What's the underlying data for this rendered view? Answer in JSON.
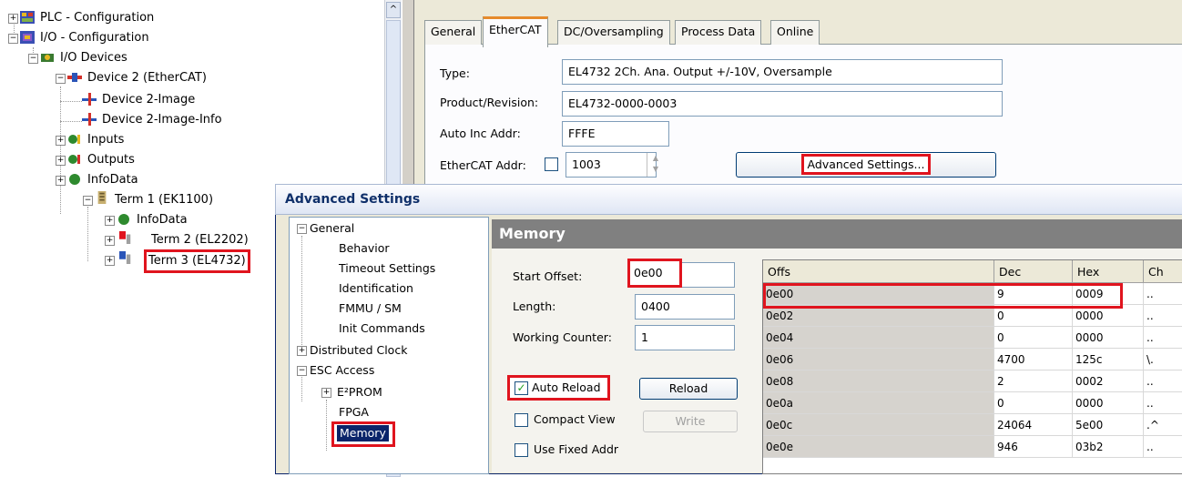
{
  "tree": {
    "items": [
      {
        "label": "PLC - Configuration"
      },
      {
        "label": "I/O - Configuration"
      },
      {
        "label": "I/O Devices"
      },
      {
        "label": "Device 2 (EtherCAT)"
      },
      {
        "label": "Device 2-Image"
      },
      {
        "label": "Device 2-Image-Info"
      },
      {
        "label": "Inputs"
      },
      {
        "label": "Outputs"
      },
      {
        "label": "InfoData"
      },
      {
        "label": "Term 1 (EK1100)"
      },
      {
        "label": "InfoData"
      },
      {
        "label": "Term 2 (EL2202)"
      },
      {
        "label": "Term 3 (EL4732)"
      }
    ],
    "scroll_up_glyph": "^"
  },
  "tabs": [
    {
      "label": "General"
    },
    {
      "label": "EtherCAT"
    },
    {
      "label": "DC/Oversampling"
    },
    {
      "label": "Process Data"
    },
    {
      "label": "Online"
    }
  ],
  "ethercat": {
    "type_label": "Type:",
    "type_value": "EL4732 2Ch. Ana. Output +/-10V, Oversample",
    "product_label": "Product/Revision:",
    "product_value": "EL4732-0000-0003",
    "autoinc_label": "Auto Inc Addr:",
    "autoinc_value": "FFFE",
    "ecataddr_label": "EtherCAT Addr:",
    "ecataddr_value": "1003",
    "advanced_button": "Advanced Settings..."
  },
  "dialog": {
    "title": "Advanced Settings",
    "nav": [
      {
        "label": "General"
      },
      {
        "label": "Behavior"
      },
      {
        "label": "Timeout Settings"
      },
      {
        "label": "Identification"
      },
      {
        "label": "FMMU / SM"
      },
      {
        "label": "Init Commands"
      },
      {
        "label": "Distributed Clock"
      },
      {
        "label": "ESC Access"
      },
      {
        "label": "E²PROM"
      },
      {
        "label": "FPGA"
      },
      {
        "label": "Memory"
      }
    ],
    "memory": {
      "header": "Memory",
      "start_offset_label": "Start Offset:",
      "start_offset_value": "0e00",
      "length_label": "Length:",
      "length_value": "0400",
      "working_counter_label": "Working Counter:",
      "working_counter_value": "1",
      "auto_reload_label": "Auto Reload",
      "auto_reload_checked": true,
      "compact_view_label": "Compact View",
      "use_fixed_addr_label": "Use Fixed Addr",
      "reload_button": "Reload",
      "write_button": "Write",
      "columns": [
        "Offs",
        "Dec",
        "Hex",
        "Ch"
      ],
      "rows": [
        {
          "offs": "0e00",
          "dec": "9",
          "hex": "0009",
          "ch": ".."
        },
        {
          "offs": "0e02",
          "dec": "0",
          "hex": "0000",
          "ch": ".."
        },
        {
          "offs": "0e04",
          "dec": "0",
          "hex": "0000",
          "ch": ".."
        },
        {
          "offs": "0e06",
          "dec": "4700",
          "hex": "125c",
          "ch": "\\."
        },
        {
          "offs": "0e08",
          "dec": "2",
          "hex": "0002",
          "ch": ".."
        },
        {
          "offs": "0e0a",
          "dec": "0",
          "hex": "0000",
          "ch": ".."
        },
        {
          "offs": "0e0c",
          "dec": "24064",
          "hex": "5e00",
          "ch": ".^"
        },
        {
          "offs": "0e0e",
          "dec": "946",
          "hex": "03b2",
          "ch": ".."
        }
      ]
    }
  },
  "colors": {
    "highlight": "#e0141e",
    "selection": "#0a246a",
    "tab_accent": "#e68b2c"
  }
}
